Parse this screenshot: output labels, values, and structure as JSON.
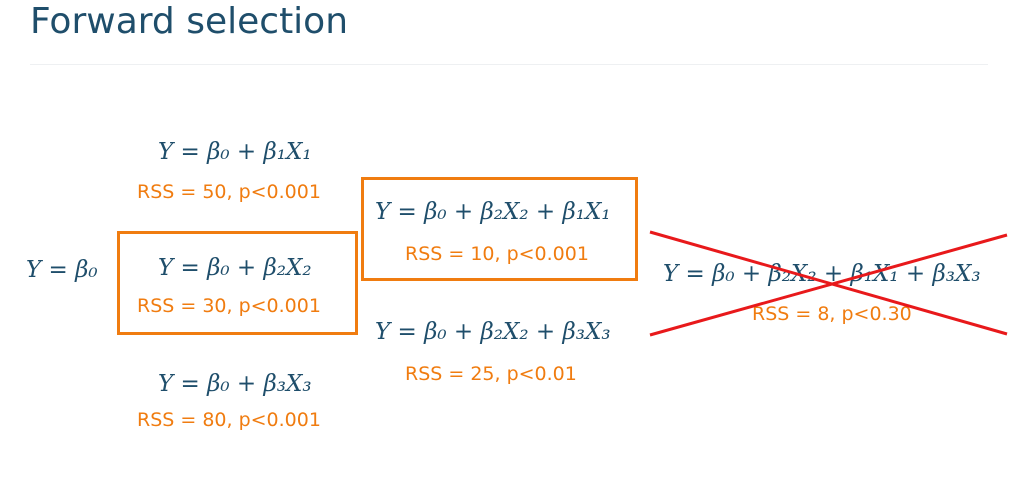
{
  "title": "Forward selection",
  "colors": {
    "title": "#1f4e6b",
    "equation": "#1f4e6b",
    "rss": "#f07c10",
    "box": "#f07c10",
    "cross": "#e8191b"
  },
  "nodes": {
    "null_model": {
      "equation": "Y = β₀"
    },
    "step1_x1": {
      "equation": "Y = β₀ + β₁X₁",
      "rss": "RSS = 50, p<0.001"
    },
    "step1_x2": {
      "equation": "Y = β₀ + β₂X₂",
      "rss": "RSS = 30, p<0.001",
      "selected": true
    },
    "step1_x3": {
      "equation": "Y = β₀ + β₃X₃",
      "rss": "RSS = 80, p<0.001"
    },
    "step2_x1": {
      "equation": "Y = β₀ + β₂X₂ + β₁X₁",
      "rss": "RSS = 10, p<0.001",
      "selected": true
    },
    "step2_x3": {
      "equation": "Y = β₀ + β₂X₂ + β₃X₃",
      "rss": "RSS = 25, p<0.01"
    },
    "step3_x3": {
      "equation": "Y = β₀ + β₂X₂ + β₁X₁ + β₃X₃",
      "rss": "RSS = 8, p<0.30",
      "rejected": true
    }
  }
}
